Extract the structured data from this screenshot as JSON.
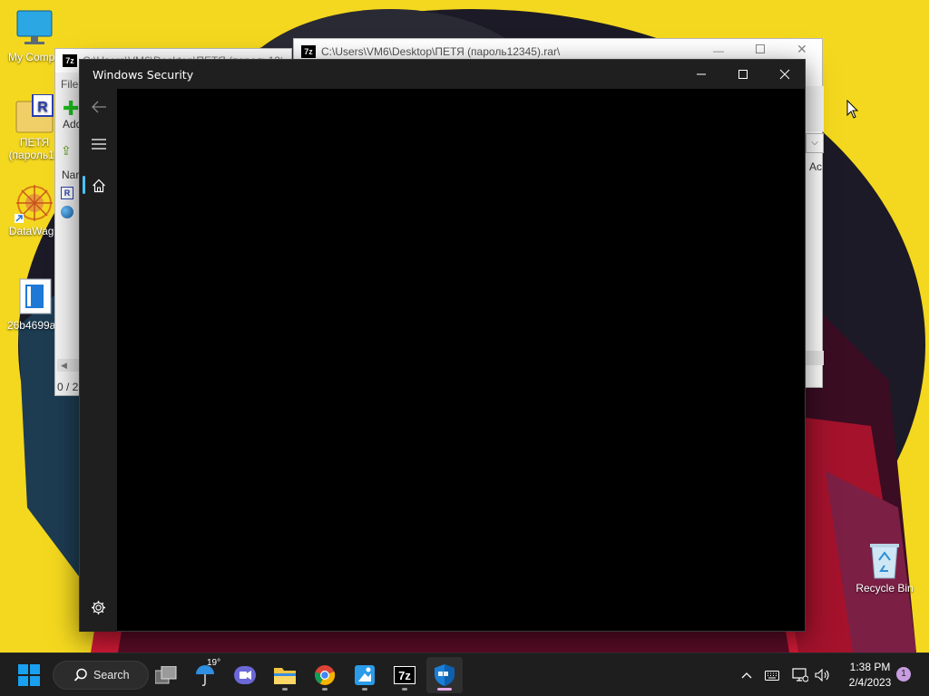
{
  "desktop": {
    "icons": [
      {
        "label": "My Compu"
      },
      {
        "label": "ПЕТЯ (пароль12"
      },
      {
        "label": "DataWago"
      },
      {
        "label": "26b4699a7"
      }
    ],
    "recycle_bin": "Recycle Bin"
  },
  "archive_window": {
    "title": "C:\\Users\\VM6\\Desktop\\ПЕТЯ (пароль12345).rar\\",
    "side_label": "Ac"
  },
  "fm_window": {
    "title": "C:\\Users\\VM6\\Desktop\\ПЕТЯ (пароль12345).rar\\",
    "menu_file": "File",
    "add_label": "Add",
    "col_name": "Nar",
    "status": "0 / 2"
  },
  "security_window": {
    "title": "Windows Security",
    "accent": "#4cc2ff"
  },
  "taskbar": {
    "search_label": "Search",
    "weather_temp": "19°",
    "sevenzip_label": "7z",
    "time": "1:38 PM",
    "date": "2/4/2023",
    "notification_count": "1",
    "apps": [
      "start-icon",
      "task-view-icon",
      "weather-icon",
      "teams-chat-icon",
      "file-explorer-icon",
      "chrome-icon",
      "paint-icon",
      "7zip-icon",
      "windows-security-icon"
    ]
  }
}
